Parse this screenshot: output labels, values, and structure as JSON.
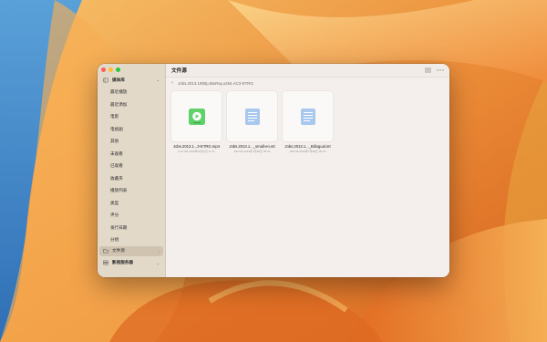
{
  "window": {
    "title": "文件源"
  },
  "sidebar": {
    "library_header": "媒体库",
    "library_items": [
      {
        "label": "最近播放"
      },
      {
        "label": "最近添加"
      },
      {
        "label": "电影"
      },
      {
        "label": "电视剧"
      },
      {
        "label": "其他"
      },
      {
        "label": "未观看"
      },
      {
        "label": "已观看"
      },
      {
        "label": "收藏夹"
      },
      {
        "label": "播放列表"
      },
      {
        "label": "类型"
      },
      {
        "label": "评分"
      },
      {
        "label": "发行日期"
      },
      {
        "label": "分组"
      }
    ],
    "sources_label": "文件源",
    "server_label": "影视服务器"
  },
  "pathbar": {
    "path": "Jobs.2013.1080p.BluRay.x264.AC3-ETRG"
  },
  "files": [
    {
      "name": "Jobs.2013.1...3-ETRG.mp4",
      "meta": "3.24 GB 2023年10月2日 17:11",
      "type": "video"
    },
    {
      "name": "Jobs.2013.1..._small-en.srt",
      "meta": "182 KB 2023年7月28日 05:43",
      "type": "subtitle"
    },
    {
      "name": "Jobs.2013.1..._Bilingual.srt",
      "meta": "186 KB 2023年7月28日 05:43",
      "type": "subtitle"
    }
  ],
  "colors": {
    "sidebar_bg": "#e3d9c9",
    "content_bg": "#f4efec",
    "video_icon": "#5fd16a",
    "doc_icon": "#9fc0ea"
  }
}
